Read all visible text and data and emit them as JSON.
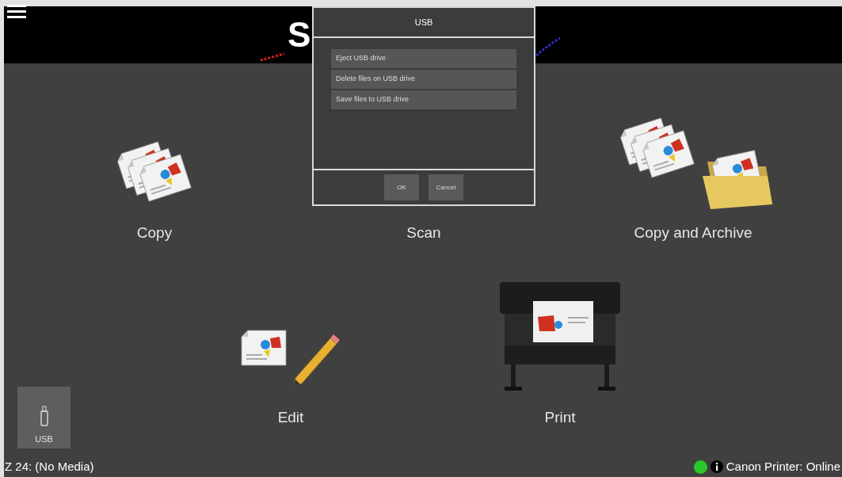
{
  "header": {
    "logo_text": "S"
  },
  "tiles": [
    {
      "label": "Copy",
      "kind": "copy"
    },
    {
      "label": "Scan",
      "kind": "scan"
    },
    {
      "label": "Copy and Archive",
      "kind": "archive"
    },
    {
      "label": "Edit",
      "kind": "edit"
    },
    {
      "label": "Print",
      "kind": "print"
    }
  ],
  "usb_button": {
    "label": "USB"
  },
  "dialog": {
    "title": "USB",
    "options": [
      {
        "label": "Eject USB drive"
      },
      {
        "label": "Delete files on USB drive"
      },
      {
        "label": "Save files to USB drive"
      }
    ],
    "buttons": [
      {
        "label": "OK"
      },
      {
        "label": "Cancel"
      }
    ]
  },
  "status_bar": {
    "media": "Z 24: (No Media)",
    "printer_status": "Canon Printer: Online"
  }
}
